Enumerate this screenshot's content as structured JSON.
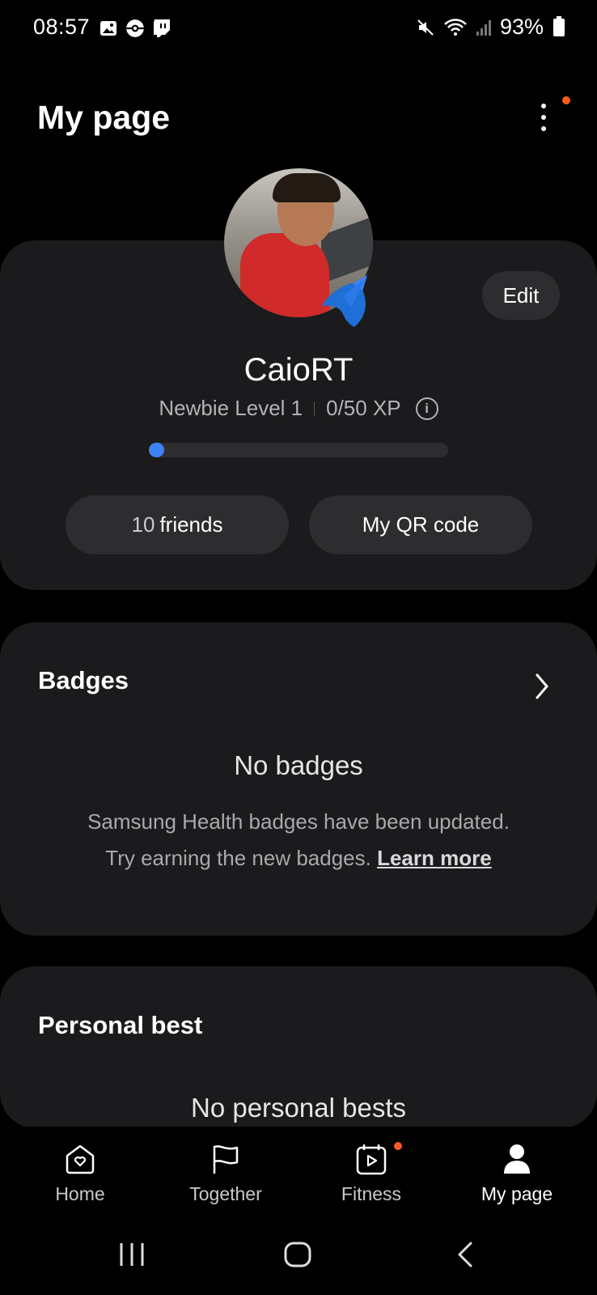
{
  "status_bar": {
    "time": "08:57",
    "battery": "93%"
  },
  "header": {
    "title": "My page"
  },
  "profile": {
    "username": "CaioRT",
    "level": "Newbie Level 1",
    "xp": "0/50 XP",
    "xp_progress": 0.05,
    "edit_label": "Edit",
    "friends_count": "10",
    "friends_label": "friends",
    "qr_label": "My QR code"
  },
  "badges": {
    "title": "Badges",
    "empty_title": "No badges",
    "desc_line1": "Samsung Health badges have been updated.",
    "desc_line2": "Try earning the new badges.",
    "learn_more": "Learn more"
  },
  "personal_best": {
    "title": "Personal best",
    "empty_title": "No personal bests"
  },
  "nav": {
    "items": [
      {
        "label": "Home",
        "icon": "home-heart-icon"
      },
      {
        "label": "Together",
        "icon": "flag-icon"
      },
      {
        "label": "Fitness",
        "icon": "play-calendar-icon"
      },
      {
        "label": "My page",
        "icon": "person-icon"
      }
    ]
  },
  "colors": {
    "accent": "#3c82f6",
    "notification": "#ff5a1f",
    "card": "#1b1b1d"
  }
}
